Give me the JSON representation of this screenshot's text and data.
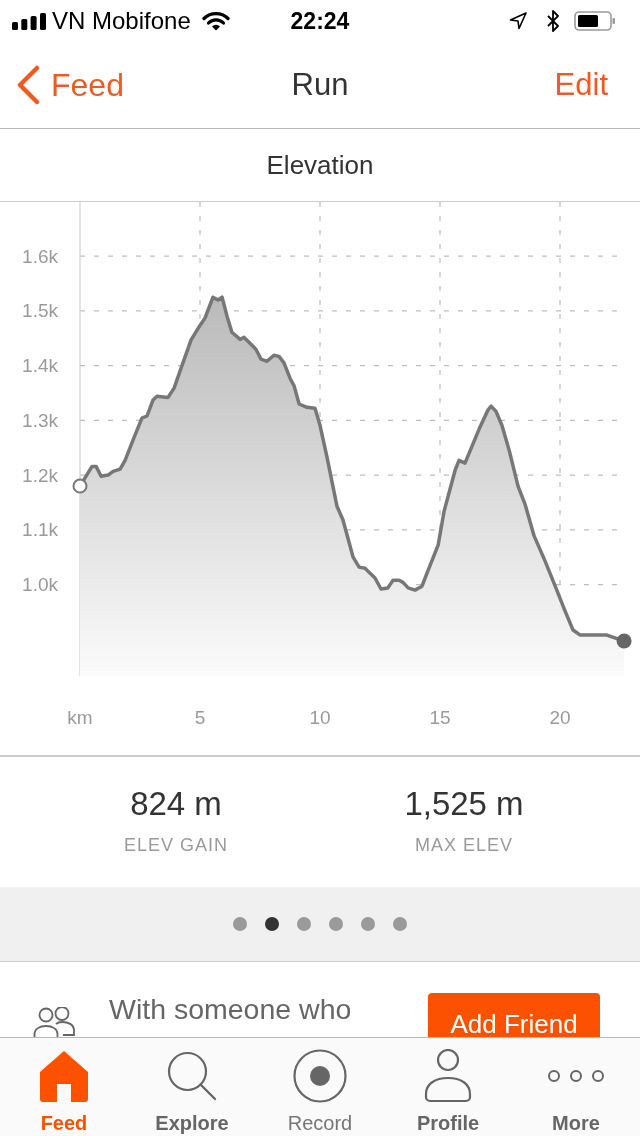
{
  "status_bar": {
    "carrier": "VN Mobifone",
    "time": "22:24"
  },
  "nav": {
    "back": "Feed",
    "title": "Run",
    "action": "Edit"
  },
  "elevation": {
    "chart_data": {
      "type": "area",
      "title": "Elevation",
      "x": [
        0,
        0.5,
        0.67,
        0.88,
        1.17,
        1.38,
        1.67,
        1.88,
        2.21,
        2.58,
        2.79,
        3.04,
        3.21,
        3.67,
        3.92,
        4.21,
        4.63,
        4.92,
        5.21,
        5.54,
        5.75,
        5.92,
        6.13,
        6.33,
        6.67,
        6.83,
        7.33,
        7.54,
        7.79,
        8.08,
        8.29,
        8.5,
        8.75,
        8.92,
        9.13,
        9.46,
        9.79,
        10.0,
        10.29,
        10.71,
        10.96,
        11.38,
        11.63,
        11.88,
        12.08,
        12.29,
        12.54,
        12.83,
        13.04,
        13.29,
        13.46,
        13.67,
        13.96,
        14.25,
        14.46,
        14.92,
        15.17,
        15.63,
        15.79,
        16.04,
        16.63,
        17.0,
        17.13,
        17.33,
        17.58,
        17.88,
        18.25,
        18.54,
        18.92,
        19.38,
        19.83,
        20.21,
        20.54,
        20.83,
        21.92,
        22.67
      ],
      "values": [
        1180,
        1216,
        1216,
        1198,
        1200,
        1207,
        1211,
        1227,
        1264,
        1304,
        1308,
        1337,
        1344,
        1342,
        1359,
        1395,
        1447,
        1468,
        1487,
        1525,
        1520,
        1525,
        1490,
        1461,
        1448,
        1452,
        1430,
        1412,
        1408,
        1419,
        1417,
        1405,
        1377,
        1363,
        1330,
        1324,
        1322,
        1291,
        1233,
        1143,
        1118,
        1050,
        1032,
        1030,
        1021,
        1012,
        992,
        994,
        1008,
        1008,
        1004,
        994,
        990,
        997,
        1021,
        1072,
        1134,
        1209,
        1227,
        1222,
        1284,
        1319,
        1326,
        1317,
        1291,
        1246,
        1180,
        1147,
        1089,
        1043,
        994,
        952,
        917,
        908,
        908,
        897
      ],
      "xlim": [
        -3.333,
        23.333
      ],
      "ylim": [
        833,
        1699
      ],
      "xticks": [
        {
          "value": 0,
          "label": "km"
        },
        5,
        10,
        15,
        20
      ],
      "yticks": [
        {
          "value": 1000,
          "label": "1.0k"
        },
        {
          "value": 1100,
          "label": "1.1k"
        },
        {
          "value": 1200,
          "label": "1.2k"
        },
        {
          "value": 1300,
          "label": "1.3k"
        },
        {
          "value": 1400,
          "label": "1.4k"
        },
        {
          "value": 1500,
          "label": "1.5k"
        },
        {
          "value": 1600,
          "label": "1.6k"
        }
      ],
      "grid": true
    }
  },
  "stats": [
    {
      "value": "824 m",
      "label": "ELEV GAIN"
    },
    {
      "value": "1,525 m",
      "label": "MAX ELEV"
    }
  ],
  "pager": [
    {
      "selected": false
    },
    {
      "selected": true
    },
    {
      "selected": false
    },
    {
      "selected": false
    },
    {
      "selected": false
    },
    {
      "selected": false
    }
  ],
  "friend_prompt": {
    "text": "With someone who",
    "button": "Add Friend"
  },
  "tabs": [
    {
      "kind": "home",
      "label": "Feed",
      "selected": true
    },
    {
      "kind": "explore",
      "label": "Explore",
      "selected": false
    },
    {
      "kind": "record",
      "label": "Record",
      "selected": false
    },
    {
      "kind": "profile",
      "label": "Profile",
      "selected": false
    },
    {
      "kind": "more",
      "label": "More",
      "selected": false
    }
  ]
}
